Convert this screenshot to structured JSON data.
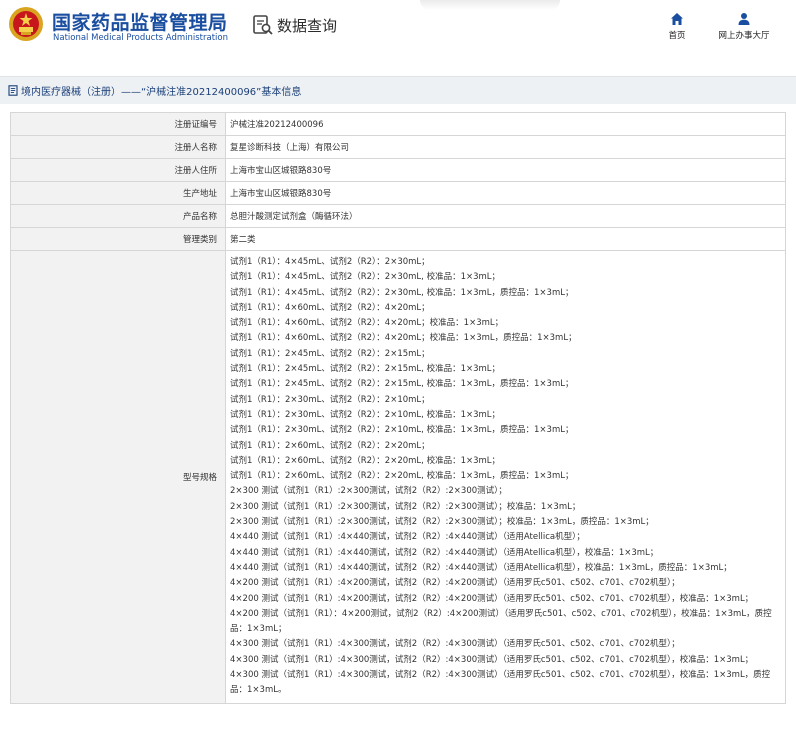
{
  "header": {
    "title_cn": "国家药品监督管理局",
    "title_en": "National Medical Products Administration",
    "query_title": "数据查询",
    "nav": {
      "home_label": "首页",
      "service_label": "网上办事大厅"
    }
  },
  "icons": {
    "emblem": "national-emblem-icon",
    "query": "document-search-icon",
    "home": "home-icon",
    "user": "user-icon",
    "breadcrumb": "document-icon"
  },
  "colors": {
    "brand_blue": "#1a4ea0",
    "label_bg": "#f2f2f2",
    "breadcrumb_bg": "#eef1f4"
  },
  "breadcrumb": {
    "text": "境内医疗器械（注册）——“沪械注准20212400096”基本信息"
  },
  "detail": {
    "rows": [
      {
        "label": "注册证编号",
        "value": "沪械注准20212400096"
      },
      {
        "label": "注册人名称",
        "value": "复星诊断科技（上海）有限公司"
      },
      {
        "label": "注册人住所",
        "value": "上海市宝山区城银路830号"
      },
      {
        "label": "生产地址",
        "value": "上海市宝山区城银路830号"
      },
      {
        "label": "产品名称",
        "value": "总胆汁酸测定试剂盒（酶循环法）"
      },
      {
        "label": "管理类别",
        "value": "第二类"
      }
    ],
    "spec_label": "型号规格",
    "spec_lines": [
      "试剂1（R1）：4×45mL、试剂2（R2）：2×30mL；",
      "试剂1（R1）：4×45mL、试剂2（R2）：2×30mL, 校准品：1×3mL；",
      "试剂1（R1）：4×45mL、试剂2（R2）：2×30mL, 校准品：1×3mL，质控品：1×3mL；",
      "试剂1（R1）：4×60mL、试剂2（R2）：4×20mL；",
      "试剂1（R1）：4×60mL、试剂2（R2）：4×20mL；校准品：1×3mL；",
      "试剂1（R1）：4×60mL、试剂2（R2）：4×20mL；校准品：1×3mL，质控品：1×3mL；",
      "试剂1（R1）：2×45mL、试剂2（R2）：2×15mL；",
      "试剂1（R1）：2×45mL、试剂2（R2）：2×15mL, 校准品：1×3mL；",
      "试剂1（R1）：2×45mL、试剂2（R2）：2×15mL, 校准品：1×3mL，质控品：1×3mL；",
      "试剂1（R1）：2×30mL、试剂2（R2）：2×10mL；",
      "试剂1（R1）：2×30mL、试剂2（R2）：2×10mL, 校准品：1×3mL；",
      "试剂1（R1）：2×30mL、试剂2（R2）：2×10mL, 校准品：1×3mL，质控品：1×3mL；",
      "试剂1（R1）：2×60mL、试剂2（R2）：2×20mL；",
      "试剂1（R1）：2×60mL、试剂2（R2）：2×20mL, 校准品：1×3mL；",
      "试剂1（R1）：2×60mL、试剂2（R2）：2×20mL, 校准品：1×3mL，质控品：1×3mL；",
      "2×300 测试（试剂1（R1）:2×300测试，试剂2（R2）:2×300测试）；",
      "2×300 测试（试剂1（R1）:2×300测试，试剂2（R2）:2×300测试）；校准品：1×3mL；",
      "2×300 测试（试剂1（R1）:2×300测试，试剂2（R2）:2×300测试）；校准品：1×3mL，质控品：1×3mL；",
      "4×440 测试（试剂1（R1）:4×440测试，试剂2（R2）:4×440测试）（适用Atellica机型）；",
      "4×440 测试（试剂1（R1）:4×440测试，试剂2（R2）:4×440测试）（适用Atellica机型），校准品：1×3mL；",
      "4×440 测试（试剂1（R1）:4×440测试，试剂2（R2）:4×440测试）（适用Atellica机型），校准品：1×3mL，质控品：1×3mL；",
      "4×200 测试（试剂1（R1）:4×200测试，试剂2（R2）:4×200测试）（适用罗氏c501、c502、c701、c702机型）；",
      "4×200 测试（试剂1（R1）:4×200测试，试剂2（R2）:4×200测试）（适用罗氏c501、c502、c701、c702机型），校准品：1×3mL；",
      "4×200 测试（试剂1（R1）：4×200测试，试剂2（R2）:4×200测试）（适用罗氏c501、c502、c701、c702机型），校准品：1×3mL，质控品：1×3mL；",
      "4×300 测试（试剂1（R1）:4×300测试，试剂2（R2）:4×300测试）（适用罗氏c501、c502、c701、c702机型）；",
      "4×300 测试（试剂1（R1）:4×300测试，试剂2（R2）:4×300测试）（适用罗氏c501、c502、c701、c702机型），校准品：1×3mL；",
      "4×300 测试（试剂1（R1）:4×300测试，试剂2（R2）:4×300测试）（适用罗氏c501、c502、c701、c702机型），校准品：1×3mL，质控品：1×3mL。"
    ]
  }
}
